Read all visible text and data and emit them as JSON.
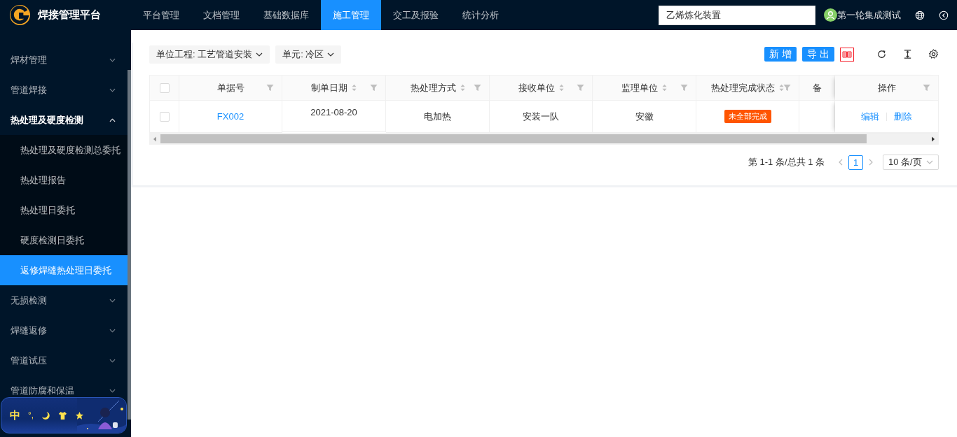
{
  "app": {
    "title": "焊接管理平台"
  },
  "nav": [
    {
      "label": "平台管理",
      "selected": false
    },
    {
      "label": "文档管理",
      "selected": false
    },
    {
      "label": "基础数据库",
      "selected": false
    },
    {
      "label": "施工管理",
      "selected": true
    },
    {
      "label": "交工及报验",
      "selected": false
    },
    {
      "label": "统计分析",
      "selected": false
    }
  ],
  "project_search": {
    "value": "乙烯炼化装置"
  },
  "user": {
    "name": "第一轮集成测试"
  },
  "sidebar": {
    "items": [
      {
        "label": "焊材管理",
        "expanded": false
      },
      {
        "label": "管道焊接",
        "expanded": false
      },
      {
        "label": "热处理及硬度检测",
        "expanded": true,
        "children": [
          {
            "label": "热处理及硬度检测总委托",
            "selected": false
          },
          {
            "label": "热处理报告",
            "selected": false
          },
          {
            "label": "热处理日委托",
            "selected": false
          },
          {
            "label": "硬度检测日委托",
            "selected": false
          },
          {
            "label": "返修焊缝热处理日委托",
            "selected": true
          }
        ]
      },
      {
        "label": "无损检测",
        "expanded": false
      },
      {
        "label": "焊缝返修",
        "expanded": false
      },
      {
        "label": "管道试压",
        "expanded": false
      },
      {
        "label": "管道防腐和保温",
        "expanded": false
      }
    ]
  },
  "filters": [
    {
      "label": "单位工程: 工艺管道安装"
    },
    {
      "label": "单元: 冷区"
    }
  ],
  "toolbar": {
    "buttons": [
      "新 增",
      "导 出"
    ]
  },
  "table": {
    "header_checked": false,
    "columns": [
      {
        "label": "单据号",
        "sortable": false,
        "filter": true
      },
      {
        "label": "制单日期",
        "sortable": true,
        "filter": true
      },
      {
        "label": "热处理方式",
        "sortable": true,
        "filter": true
      },
      {
        "label": "接收单位",
        "sortable": true,
        "filter": true
      },
      {
        "label": "监理单位",
        "sortable": true,
        "filter": true
      },
      {
        "label": "热处理完成状态",
        "sortable": true,
        "filter": true
      },
      {
        "label": "备",
        "sortable": false,
        "filter": false
      },
      {
        "label": "操作",
        "sortable": false,
        "filter": true
      }
    ],
    "rows": [
      {
        "selected": false,
        "cells": [
          {
            "kind": "link",
            "text": "FX002"
          },
          {
            "kind": "date",
            "text": "2021-08-20"
          },
          {
            "kind": "text",
            "text": "电加热"
          },
          {
            "kind": "text",
            "text": "安装一队"
          },
          {
            "kind": "text",
            "text": "安徽"
          },
          {
            "kind": "tag",
            "text": "未全部完成",
            "color": "#ff5500"
          },
          {
            "kind": "empty"
          },
          {
            "kind": "actions",
            "links": [
              "编辑",
              "删除"
            ]
          }
        ]
      }
    ]
  },
  "pagination": {
    "summary": "第 1-1 条/总共 1 条",
    "pages": [
      {
        "label": "1",
        "selected": true
      }
    ],
    "page_size": "10 条/页"
  },
  "ime": {
    "mode": "中",
    "punctuation": "°,"
  }
}
